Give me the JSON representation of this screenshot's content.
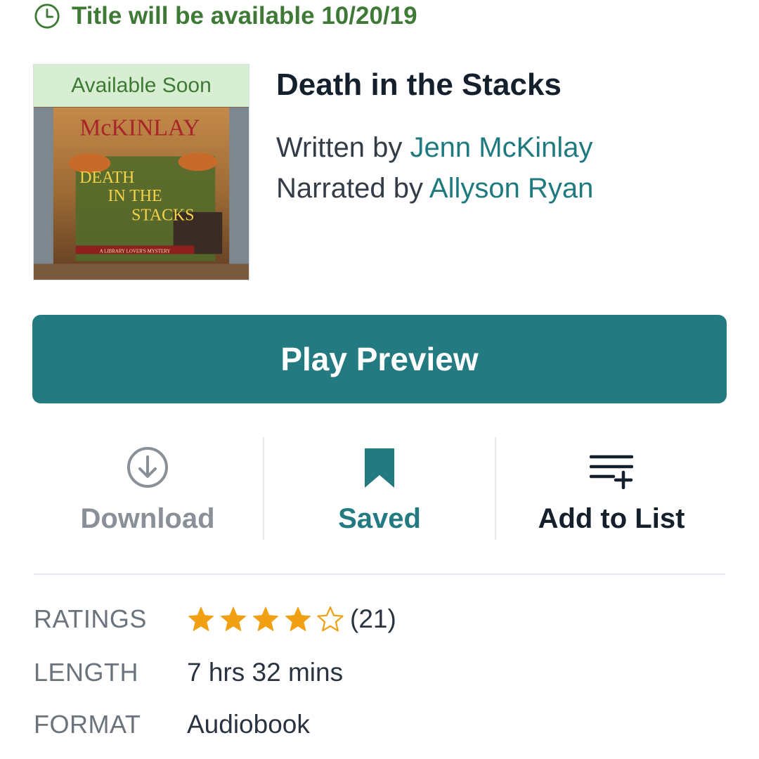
{
  "availability": {
    "text": "Title will be available 10/20/19",
    "icon": "clock-icon",
    "color": "#3e7a36"
  },
  "cover": {
    "banner": "Available Soon",
    "author_art": "McKINLAY",
    "title_art_line1": "DEATH",
    "title_art_line2": "IN THE",
    "title_art_line3": "STACKS",
    "series_art": "A LIBRARY LOVER'S MYSTERY",
    "badge_icon": "headphones-icon"
  },
  "book": {
    "title": "Death in the Stacks",
    "written_prefix": "Written by ",
    "author": "Jenn McKinlay",
    "narrated_prefix": "Narrated by ",
    "narrator": "Allyson Ryan"
  },
  "play_button": {
    "label": "Play Preview",
    "color": "#237a80"
  },
  "actions": {
    "download": {
      "label": "Download",
      "icon": "download-icon"
    },
    "saved": {
      "label": "Saved",
      "icon": "bookmark-icon"
    },
    "add_to_list": {
      "label": "Add to List",
      "icon": "add-to-list-icon"
    }
  },
  "details": {
    "ratings": {
      "label": "RATINGS",
      "stars": 4,
      "max_stars": 5,
      "count": "(21)",
      "star_color": "#f0a012"
    },
    "length": {
      "label": "LENGTH",
      "value": "7 hrs 32 mins"
    },
    "format": {
      "label": "FORMAT",
      "value": "Audiobook"
    }
  }
}
